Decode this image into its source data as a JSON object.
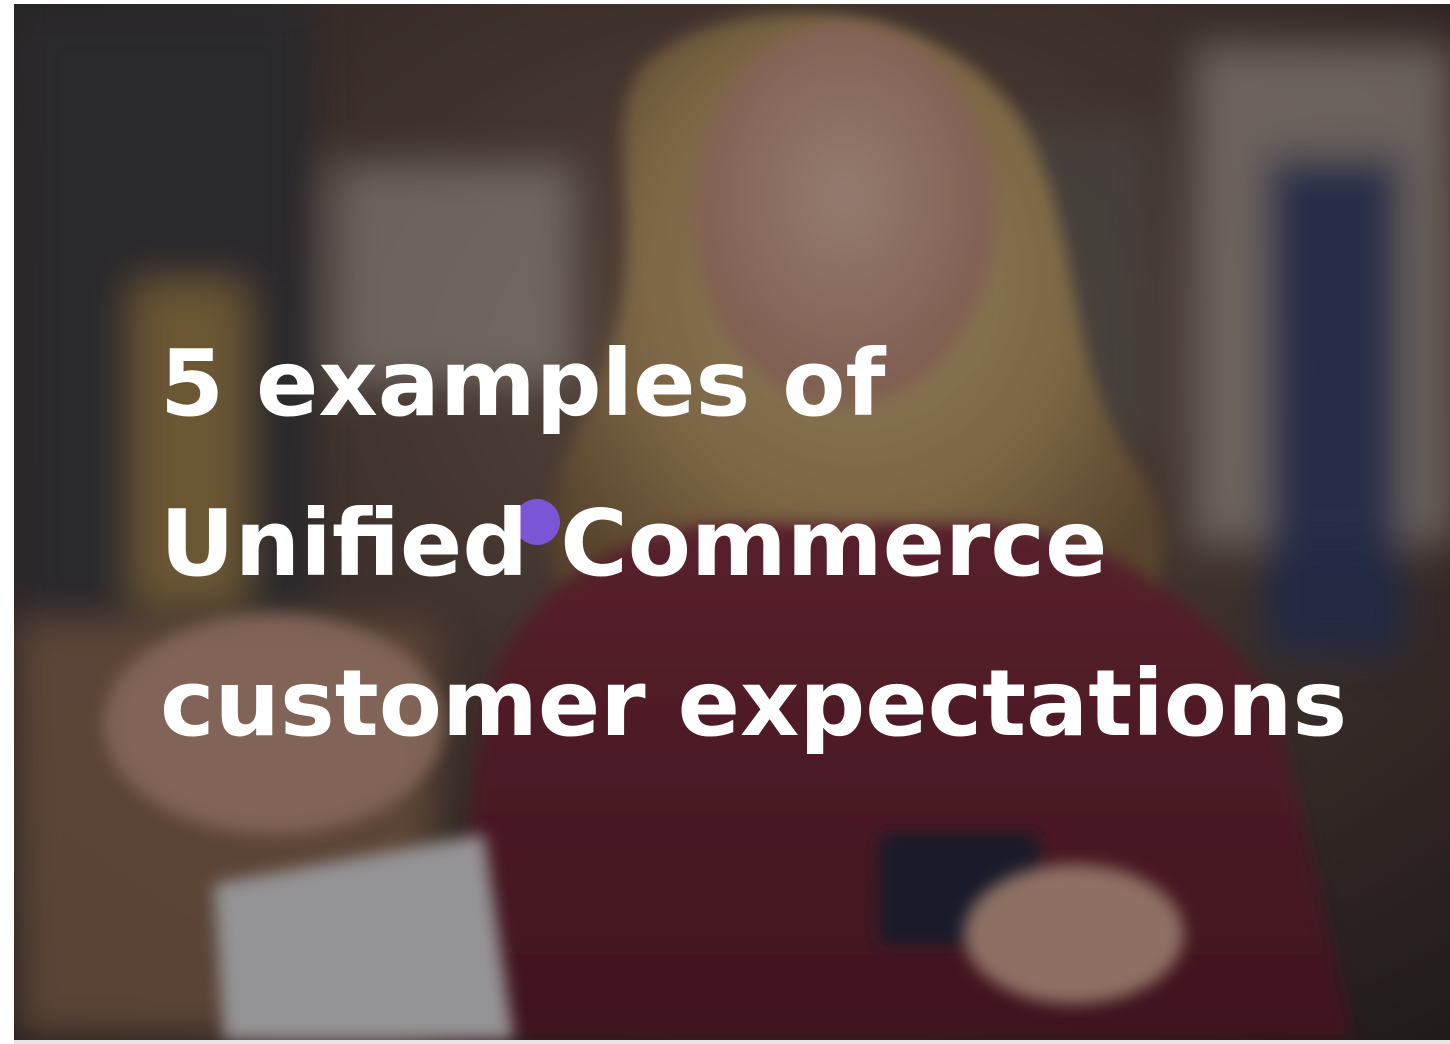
{
  "hero": {
    "headline_lines": [
      "5 examples of",
      "Unified Commerce",
      "customer expectations"
    ],
    "image_icon": "photo-woman-paying-with-card",
    "overlay_color": "#141016",
    "accent_color": "#7a55d6",
    "text_color": "#ffffff"
  }
}
